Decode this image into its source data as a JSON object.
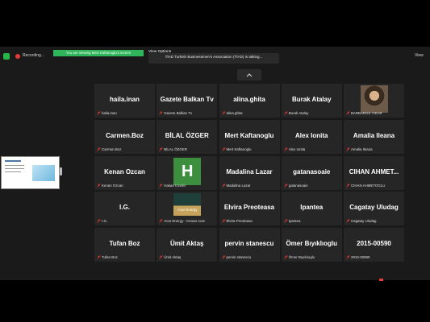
{
  "topbar": {
    "recording_label": "Recording...",
    "viewing_banner": "You are viewing Mert Kaftanoglu's screen",
    "view_options": "View Options",
    "talking_text": "TİAD Turkish Businessmen's Association (TİAD) is talking...",
    "view_label": "View"
  },
  "tiles": [
    {
      "name": "haila.inan",
      "label": "haila.inan"
    },
    {
      "name": "Gazete Balkan Tv",
      "label": "Gazete Balkan Tv"
    },
    {
      "name": "alina.ghita",
      "label": "alina.ghita"
    },
    {
      "name": "Burak Atalay",
      "label": "Burak Atalay"
    },
    {
      "name": "",
      "label": "BARBAROS YIKAR",
      "avatar": "photo"
    },
    {
      "name": "Carmen.Boz",
      "label": "Carmen.Boz"
    },
    {
      "name": "BİLAL ÖZGER",
      "label": "BİLAL ÖZGER"
    },
    {
      "name": "Mert Kaftanoglu",
      "label": "Mert Kaftanoglu"
    },
    {
      "name": "Alex Ionita",
      "label": "Alex Ionita"
    },
    {
      "name": "Amalia Ileana",
      "label": "Amalia Ileana"
    },
    {
      "name": "Kenan Ozcan",
      "label": "Kenan Ozcan"
    },
    {
      "name": "",
      "label": "Hakan İnceler",
      "avatar": "H"
    },
    {
      "name": "Madalina Lazar",
      "label": "Madalina Lazar"
    },
    {
      "name": "gatanasoaie",
      "label": "gatanasoaie"
    },
    {
      "name": "CIHAN AHMET...",
      "label": "CIHAN AHMETOGLU"
    },
    {
      "name": "I.G.",
      "label": "I.G."
    },
    {
      "name": "",
      "label": "Acar Energy - Kenan Acar",
      "avatar": "logo",
      "logo_text": "Acar Energy"
    },
    {
      "name": "Elvira Preoteasa",
      "label": "Elvira Preoteasa"
    },
    {
      "name": "Ipantea",
      "label": "Ipantea"
    },
    {
      "name": "Cagatay Uludag",
      "label": "Cagatay Uludag"
    },
    {
      "name": "Tufan Boz",
      "label": "Tufan Boz"
    },
    {
      "name": "Ümit Aktaş",
      "label": "Ümit Aktaş"
    },
    {
      "name": "pervin stanescu",
      "label": "pervin stanescu"
    },
    {
      "name": "Ömer Bıyıklıoglu",
      "label": "Ömer Bıyıklıoglu"
    },
    {
      "name": "2015-00590",
      "label": "2015-00590"
    }
  ],
  "colors": {
    "mic_muted": "#e53935",
    "banner": "#2fb55a"
  }
}
